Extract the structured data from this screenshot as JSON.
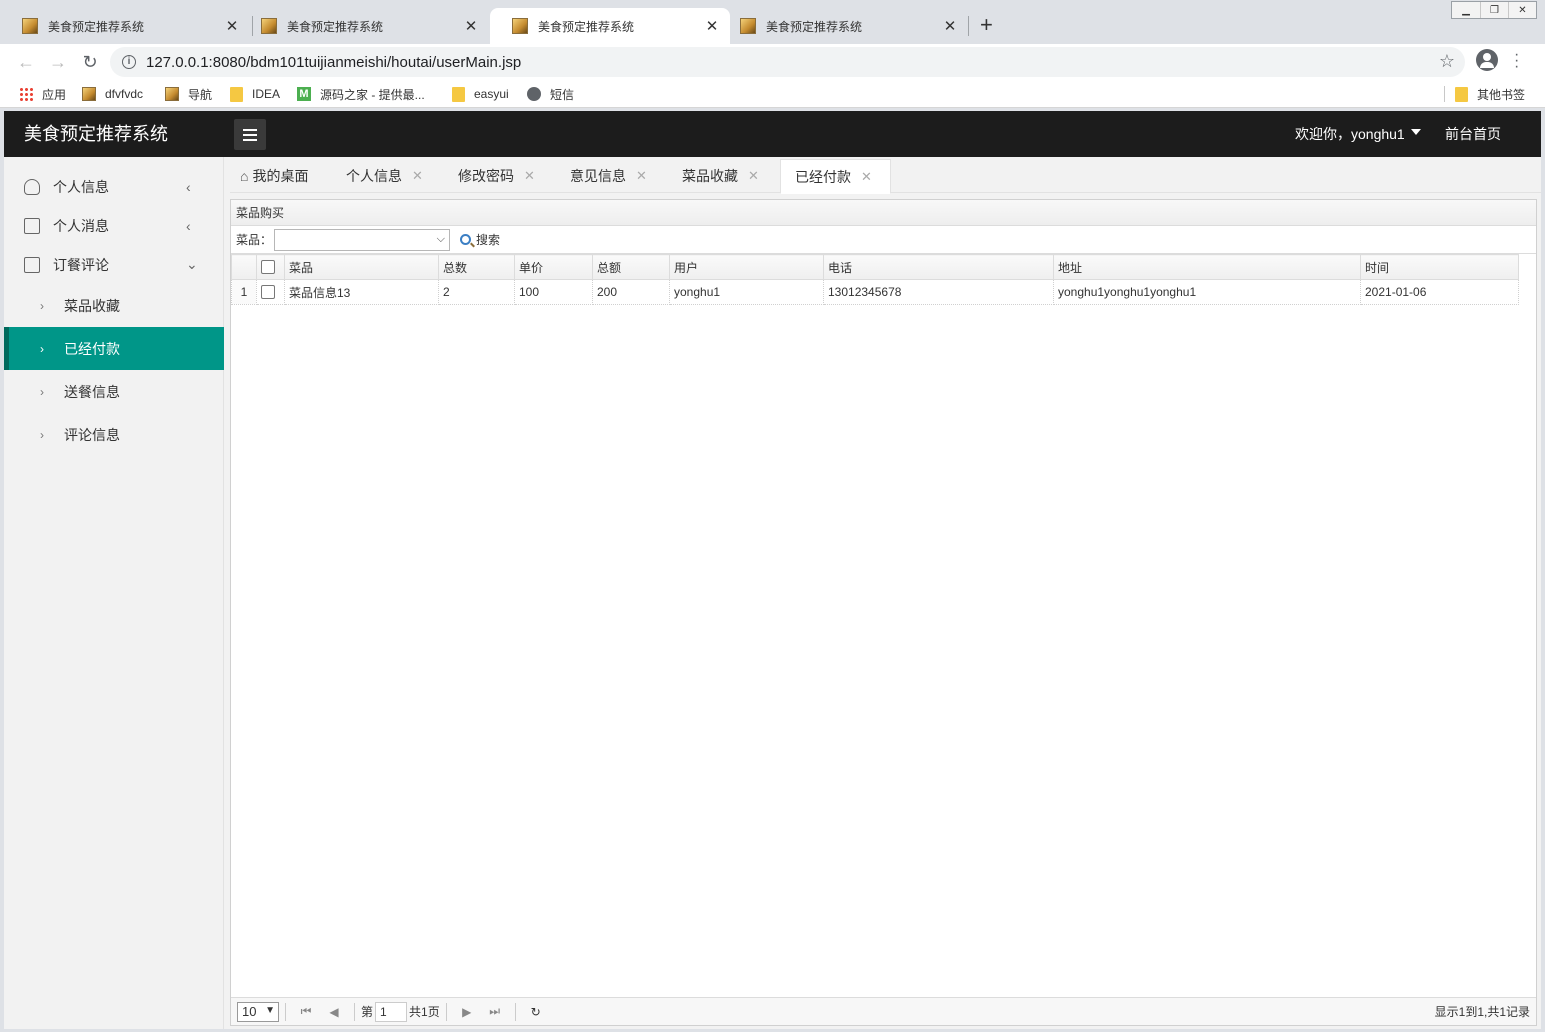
{
  "browser": {
    "tabs": [
      {
        "title": "美食预定推荐系统",
        "active": false
      },
      {
        "title": "美食预定推荐系统",
        "active": false
      },
      {
        "title": "美食预定推荐系统",
        "active": true
      },
      {
        "title": "美食预定推荐系统",
        "active": false
      }
    ],
    "url": "127.0.0.1:8080/bdm101tuijianmeishi/houtai/userMain.jsp",
    "bookmarks": [
      {
        "label": "应用",
        "icon": "apps-grid-icon"
      },
      {
        "label": "dfvfvdc",
        "icon": "page-icon"
      },
      {
        "label": "导航",
        "icon": "page-icon"
      },
      {
        "label": "IDEA",
        "icon": "folder-icon"
      },
      {
        "label": "源码之家 - 提供最...",
        "icon": "m-logo-icon"
      },
      {
        "label": "easyui",
        "icon": "folder-icon"
      },
      {
        "label": "短信",
        "icon": "globe-icon"
      }
    ],
    "other_bookmarks": "其他书签"
  },
  "app": {
    "title": "美食预定推荐系统",
    "welcome": "欢迎你，yonghu1",
    "front_link": "前台首页",
    "sidebar": {
      "groups": [
        {
          "label": "个人信息",
          "icon": "user-icon",
          "expanded": false
        },
        {
          "label": "个人消息",
          "icon": "document-icon",
          "expanded": false
        },
        {
          "label": "订餐评论",
          "icon": "document-icon",
          "expanded": true
        }
      ],
      "subitems": [
        {
          "label": "菜品收藏",
          "active": false
        },
        {
          "label": "已经付款",
          "active": true
        },
        {
          "label": "送餐信息",
          "active": false
        },
        {
          "label": "评论信息",
          "active": false
        }
      ]
    },
    "tabs": [
      {
        "label": "我的桌面",
        "icon": "home-icon",
        "closable": false,
        "active": false
      },
      {
        "label": "个人信息",
        "closable": true,
        "active": false
      },
      {
        "label": "修改密码",
        "closable": true,
        "active": false
      },
      {
        "label": "意见信息",
        "closable": true,
        "active": false
      },
      {
        "label": "菜品收藏",
        "closable": true,
        "active": false
      },
      {
        "label": "已经付款",
        "closable": true,
        "active": true
      }
    ]
  },
  "grid": {
    "panel_title": "菜品购买",
    "filter_label": "菜品：",
    "filter_value": "",
    "search_label": "搜索",
    "columns": [
      "菜品",
      "总数",
      "单价",
      "总额",
      "用户",
      "电话",
      "地址",
      "时间"
    ],
    "rows": [
      {
        "rownum": "1",
        "cells": [
          "菜品信息13",
          "2",
          "100",
          "200",
          "yonghu1",
          "13012345678",
          "yonghu1yonghu1yonghu1",
          "2021-01-06"
        ]
      }
    ]
  },
  "pager": {
    "page_size": "10",
    "page_prefix": "第",
    "page_value": "1",
    "page_total": "共1页",
    "info": "显示1到1,共1记录"
  },
  "colors": {
    "header_bg": "#1c1c1c",
    "active_menu": "#009688",
    "sidebar_bg": "#f2f2f2"
  }
}
